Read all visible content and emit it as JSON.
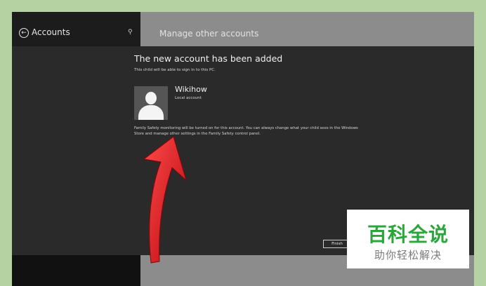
{
  "left_panel": {
    "title": "Accounts",
    "back_icon": "back-arrow-icon",
    "search_icon": "search-icon"
  },
  "right_panel": {
    "title": "Manage other accounts"
  },
  "dialog": {
    "heading": "The new account has been added",
    "subtext": "This child will be able to sign in to this PC.",
    "user_name": "Wikihow",
    "user_type": "Local account",
    "family_note": "Family Safety monitoring will be turned on for this account. You can always change what your child sees in the Windows Store and manage other settings in the Family Safety control panel.",
    "finish_label": "Finish"
  },
  "watermark": {
    "main": "百科全说",
    "sub": "助你轻松解决"
  },
  "colors": {
    "background": "#b5d3a2",
    "dialog": "#2a2a2a",
    "right_panel": "#8c8c8c",
    "arrow": "#e01b22",
    "watermark_green": "#2aa63b"
  }
}
